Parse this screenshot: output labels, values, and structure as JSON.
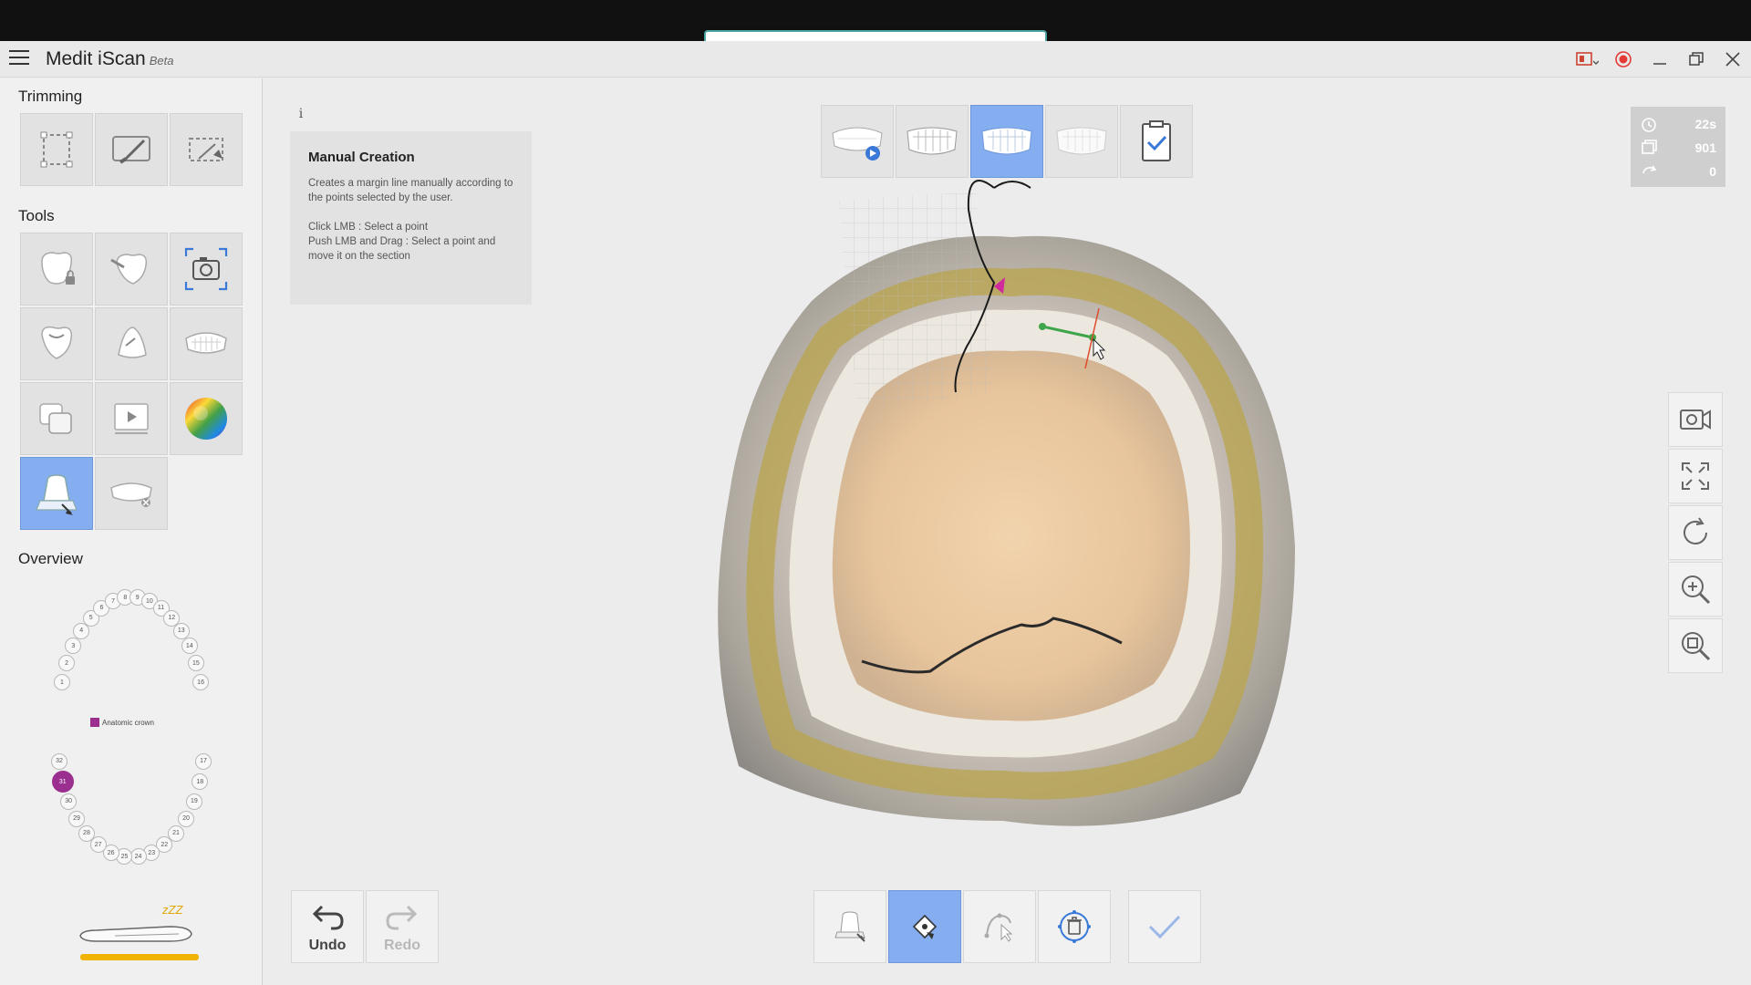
{
  "app": {
    "title": "Medit iScan",
    "badge": "Beta"
  },
  "search": {
    "value": ""
  },
  "left_panel": {
    "trimming_label": "Trimming",
    "tools_label": "Tools",
    "overview_label": "Overview",
    "overview_legend": "Anatomic crown",
    "teeth_upper": [
      "1",
      "2",
      "3",
      "4",
      "5",
      "6",
      "7",
      "8",
      "9",
      "10",
      "11",
      "12",
      "13",
      "14",
      "15",
      "16"
    ],
    "teeth_lower": [
      "17",
      "18",
      "19",
      "20",
      "21",
      "22",
      "23",
      "24",
      "25",
      "26",
      "27",
      "28",
      "29",
      "30",
      "31",
      "32"
    ],
    "selected_tooth": "31",
    "scanner_status": "zZZ"
  },
  "info_card": {
    "icon": "i",
    "title": "Manual Creation",
    "description": "Creates a margin line manually according to the points selected by the user.",
    "line1": "Click LMB : Select a point",
    "line2": "Push LMB and Drag : Select a point and move it on the section"
  },
  "stats": {
    "time": "22s",
    "frames": "901",
    "rotations": "0"
  },
  "bottom_bar": {
    "undo_label": "Undo",
    "redo_label": "Redo"
  },
  "colors": {
    "accent_active": "#84aef0",
    "selected_tooth": "#9b2f8f",
    "scanner_bar": "#f0b400",
    "record": "#e53935"
  }
}
